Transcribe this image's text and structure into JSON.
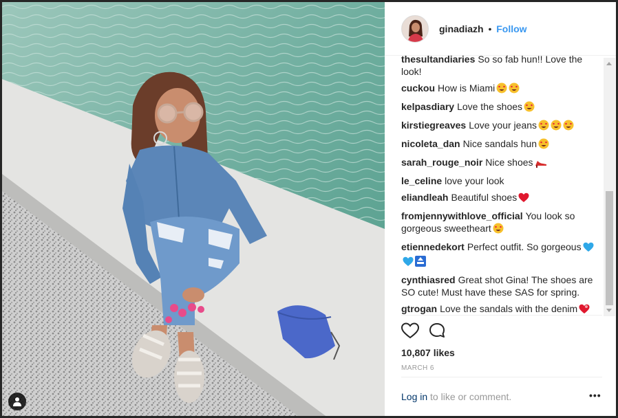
{
  "header": {
    "username": "ginadiazh",
    "separator": "•",
    "follow_label": "Follow"
  },
  "comments": [
    {
      "user": "thesultandiaries",
      "text": "So so fab hun!! Love the look!",
      "emojis": []
    },
    {
      "user": "cuckou",
      "text": "How is Miami",
      "emojis": [
        "heart-eyes-icon",
        "heart-eyes-icon"
      ]
    },
    {
      "user": "kelpasdiary",
      "text": "Love the shoes",
      "emojis": [
        "heart-eyes-icon"
      ]
    },
    {
      "user": "kirstiegreaves",
      "text": "Love your jeans",
      "emojis": [
        "heart-eyes-icon",
        "heart-eyes-icon",
        "heart-eyes-icon"
      ]
    },
    {
      "user": "nicoleta_dan",
      "text": "Nice sandals hun",
      "emojis": [
        "heart-eyes-icon"
      ]
    },
    {
      "user": "sarah_rouge_noir",
      "text": "Nice shoes",
      "emojis": [
        "high-heel-icon"
      ]
    },
    {
      "user": "le_celine",
      "text": "love your look",
      "emojis": []
    },
    {
      "user": "eliandleah",
      "text": "Beautiful shoes",
      "emojis": [
        "red-heart-icon"
      ]
    },
    {
      "user": "fromjennywithlove_official",
      "text": "You look so gorgeous sweetheart",
      "emojis": [
        "heart-eyes-icon"
      ]
    },
    {
      "user": "etiennedekort",
      "text": "Perfect outfit. So gorgeous",
      "emojis": [
        "blue-heart-icon",
        "blue-heart-icon",
        "top-arrow-icon"
      ]
    },
    {
      "user": "cynthiasred",
      "text": "Great shot Gina! The shoes are SO cute! Must have these SAS for spring.",
      "emojis": []
    },
    {
      "user": "gtrogan",
      "text": "Love the sandals with the denim",
      "emojis": [
        "heart-exclamation-icon"
      ]
    }
  ],
  "actions": {
    "like_icon": "heart-outline-icon",
    "comment_icon": "comment-bubble-icon"
  },
  "likes": "10,807 likes",
  "date": "MARCH 6",
  "footer": {
    "login_label": "Log in",
    "login_rest": " to like or comment.",
    "more_label": "•••"
  },
  "colors": {
    "link_blue": "#3897f0",
    "text": "#262626",
    "muted": "#999999",
    "login": "#003569"
  }
}
